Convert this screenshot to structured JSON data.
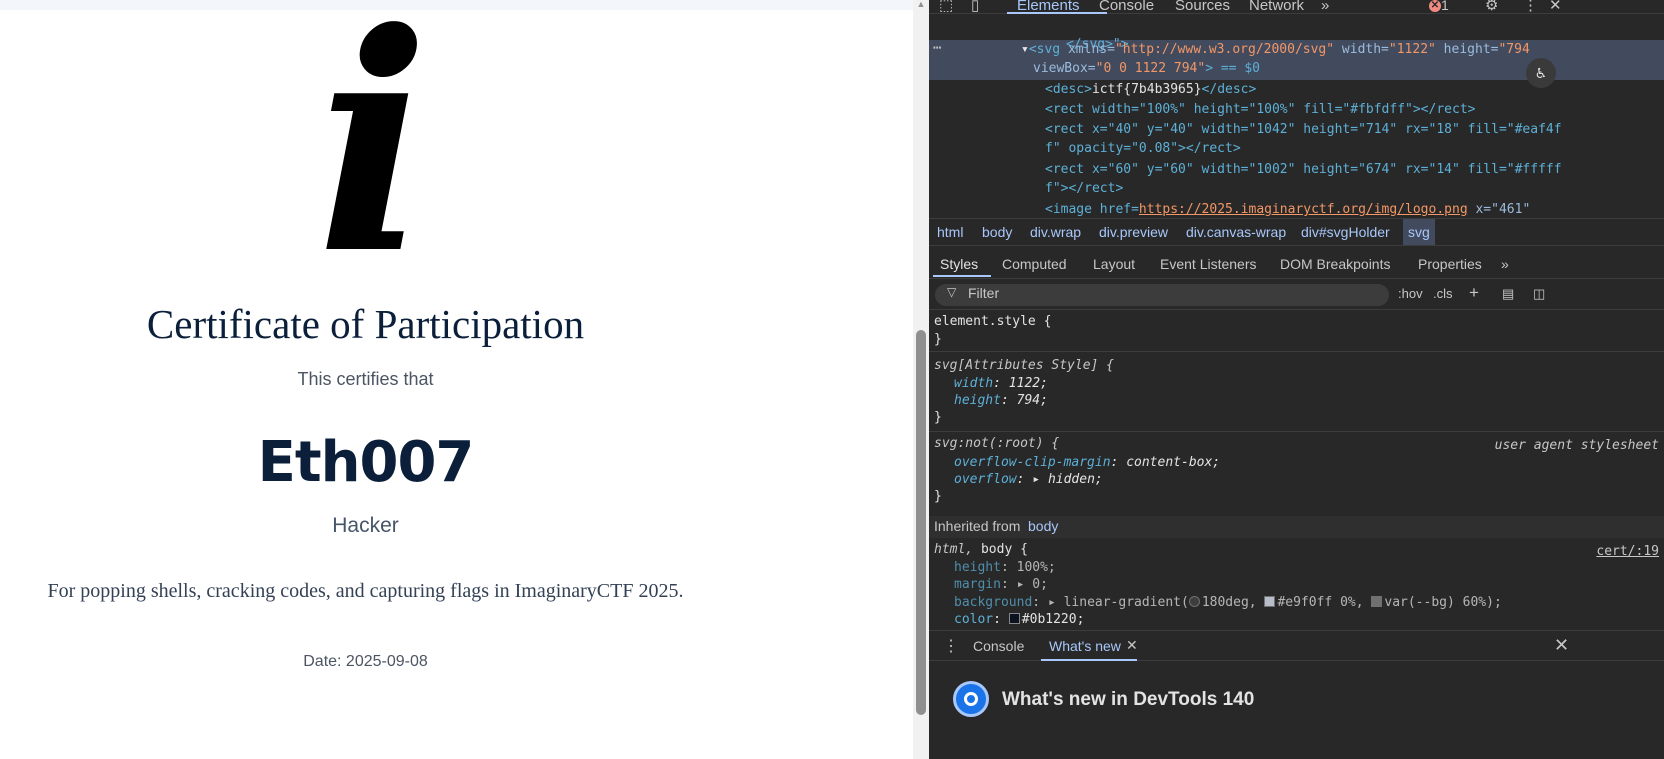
{
  "certificate": {
    "logo_glyph": "i",
    "title": "Certificate of Participation",
    "certifies": "This certifies that",
    "name": "Eth007",
    "role": "Hacker",
    "reason": "For popping shells, cracking codes, and capturing flags in ImaginaryCTF 2025.",
    "date": "Date: 2025-09-08"
  },
  "devtools": {
    "tabs": [
      "Elements",
      "Console",
      "Sources",
      "Network"
    ],
    "active_tab": "Elements",
    "more_tabs": "»",
    "error_count": "1",
    "dom": {
      "line0": "</svg>\">",
      "svg_open_tag": "<svg",
      "svg_attrs": " xmlns=",
      "svg_xmlns": "\"http://www.w3.org/2000/svg\"",
      "svg_width_attr": " width=",
      "svg_width": "\"1122\"",
      "svg_height_attr": " height=",
      "svg_height": "\"794",
      "svg_viewbox_attr": "viewBox=",
      "svg_viewbox": "\"0 0 1122 794\"",
      "svg_eq": "> == $0",
      "desc_open": "<desc>",
      "desc_text": "ictf{7b4b3965}",
      "desc_close": "</desc>",
      "rect1": "<rect width=\"100%\" height=\"100%\" fill=\"#fbfdff\"></rect>",
      "rect2a": "<rect x=\"40\" y=\"40\" width=\"1042\" height=\"714\" rx=\"18\" fill=\"#eaf4f",
      "rect2b": "f\" opacity=\"0.08\"></rect>",
      "rect3a": "<rect x=\"60\" y=\"60\" width=\"1002\" height=\"674\" rx=\"14\" fill=\"#fffff",
      "rect3b": "f\"></rect>",
      "image_open": "<image href=",
      "image_href": "https://2025.imaginaryctf.org/img/logo.png",
      "image_rest": " x=\"461\""
    },
    "breadcrumb": [
      "html",
      "body",
      "div.wrap",
      "div.preview",
      "div.canvas-wrap",
      "div#svgHolder",
      "svg"
    ],
    "style_tabs": [
      "Styles",
      "Computed",
      "Layout",
      "Event Listeners",
      "DOM Breakpoints",
      "Properties"
    ],
    "filter_placeholder": "Filter",
    "filter_tools": [
      ":hov",
      ".cls",
      "+"
    ],
    "rules": {
      "element_style": "element.style {",
      "close": "}",
      "attr_style_sel": "svg[Attributes Style] {",
      "width_prop": "width",
      "width_val": "1122;",
      "height_prop": "height",
      "height_val": "794;",
      "not_root_sel": "svg:not(:root) {",
      "ua_label": "user agent stylesheet",
      "overflow_clip_prop": "overflow-clip-margin",
      "overflow_clip_val": "content-box;",
      "overflow_prop": "overflow",
      "overflow_val": "hidden;",
      "inherited_label": "Inherited from",
      "inherited_from": "body",
      "html_body_sel_a": "html, ",
      "html_body_sel_b": "body {",
      "cert_link": "cert/:19",
      "height2_prop": "height",
      "height2_val": "100%;",
      "margin_prop": "margin",
      "margin_val": "0;",
      "bg_prop": "background",
      "bg_val_a": "linear-gradient(",
      "bg_val_b": "180deg, ",
      "bg_val_c": "#e9f0ff 0%, ",
      "bg_val_d": "var(--bg) 60%);",
      "color_prop": "color",
      "color_val": "#0b1220;"
    },
    "drawer": {
      "tabs": [
        "Console",
        "What's new"
      ],
      "active": "What's new",
      "title": "What's new in DevTools 140"
    }
  },
  "colors": {
    "devtools_bg": "#282828",
    "devtools_accent": "#a8c7fa",
    "cert_title": "#0b1f3a"
  }
}
